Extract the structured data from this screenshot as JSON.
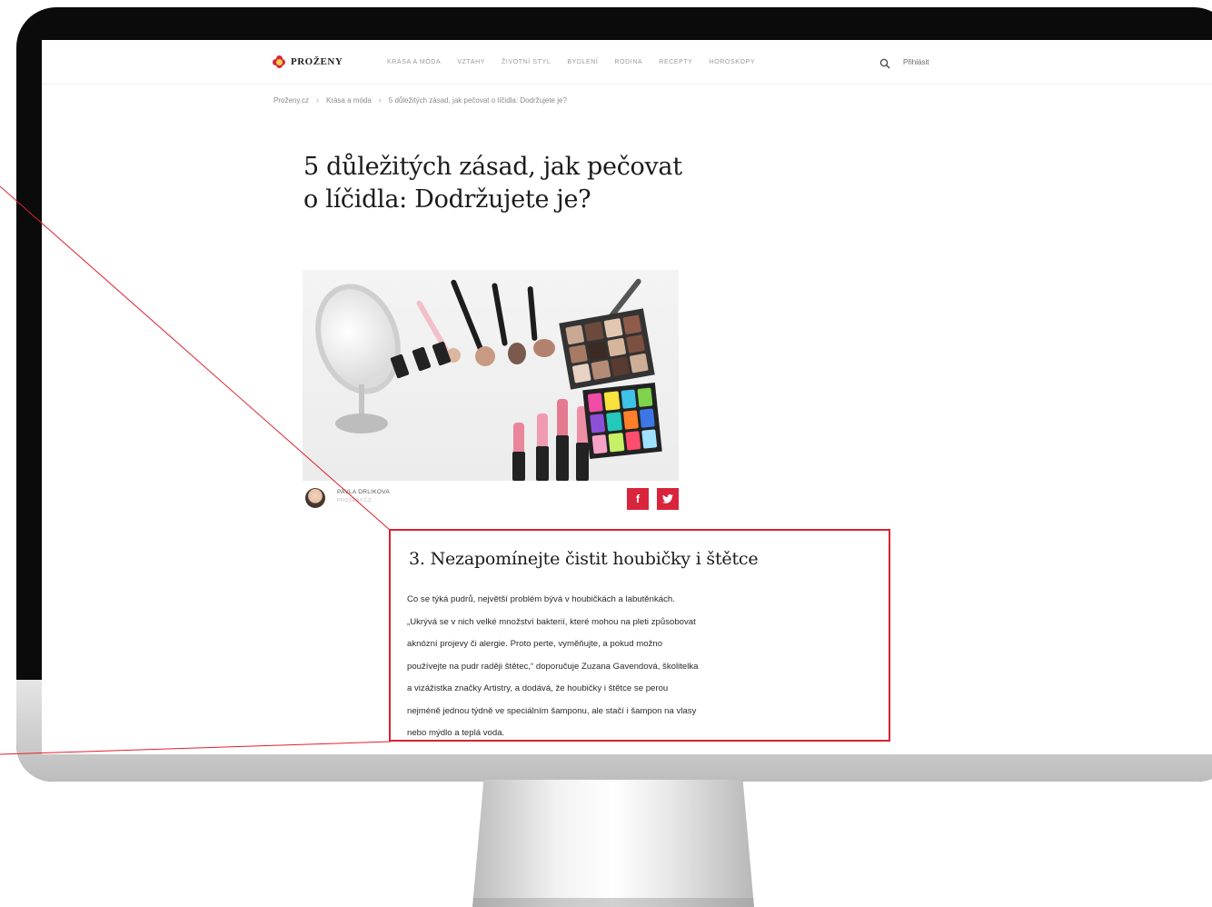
{
  "site": {
    "brand": "PROŽENY",
    "nav": [
      "KRÁSA A MÓDA",
      "VZTAHY",
      "ŽIVOTNÍ STYL",
      "BYDLENÍ",
      "RODINA",
      "RECEPTY",
      "HOROSKOPY"
    ],
    "login": "Přihlásit"
  },
  "breadcrumb": [
    "Proženy.cz",
    "Krása a móda",
    "5 důležitých zásad, jak pečovat o líčidla: Dodržujete je?"
  ],
  "article": {
    "title_line1": "5 důležitých zásad, jak pečovat",
    "title_line2": "o líčidla: Dodržujete je?",
    "author": "PAVLA DRLIKOVA",
    "author_role": "PROŽENY.CZ"
  },
  "share": {
    "facebook": "f",
    "twitter": "t"
  },
  "callout": {
    "title": "3. Nezapomínejte čistit houbičky i štětce",
    "lines": [
      "Co se týká pudrů, největší problém bývá v houbičkách a labutěnkách.",
      "„Ukrývá se v nich velké množství bakterií, které mohou na pleti způsobovat",
      "aknózní projevy či alergie. Proto perte, vyměňujte, a pokud možno",
      "používejte na pudr raději štětec,“ doporučuje Zuzana Gavendová, školitelka",
      "a vizážistka značky Artistry, a dodává, že houbičky i štětce se perou",
      "nejméně jednou týdně ve speciálním šamponu, ale stačí i šampon na vlasy",
      "nebo mýdlo a teplá voda."
    ]
  },
  "colors": {
    "accent": "#d8253b",
    "highlight": "#d8232f"
  }
}
